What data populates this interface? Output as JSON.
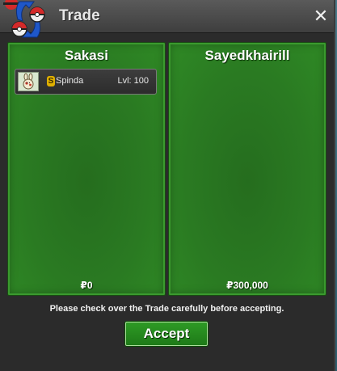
{
  "window": {
    "title": "Trade",
    "close_label": "✕"
  },
  "left_panel": {
    "trainer": "Sakasi",
    "items": [
      {
        "shiny_badge": "S",
        "name": "Spinda",
        "level": "Lvl: 100"
      }
    ],
    "money": "₽0"
  },
  "right_panel": {
    "trainer": "Sayedkhairill",
    "money": "₽300,000"
  },
  "footer": {
    "notice": "Please check over the Trade carefully before accepting.",
    "accept_label": "Accept"
  },
  "colors": {
    "panel_green": "#2a7a22",
    "button_green": "#2e9a25",
    "shiny_gold": "#e0b000"
  },
  "icons": {
    "logo": "trade-logo-icon",
    "close": "close-icon",
    "shiny": "shiny-badge-icon",
    "sprite": "spinda-sprite-icon"
  }
}
